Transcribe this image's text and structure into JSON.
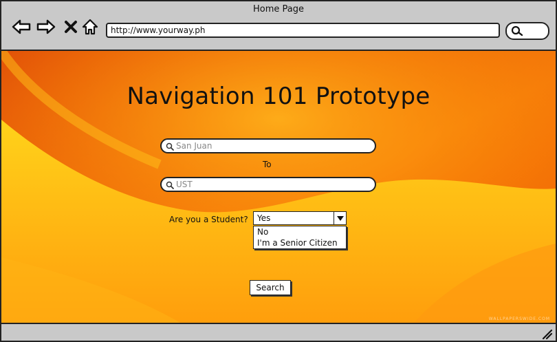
{
  "window": {
    "title": "Home Page",
    "url": "http://www.yourway.ph",
    "nav_icons": [
      "back-arrow-icon",
      "forward-arrow-icon",
      "close-icon",
      "home-icon"
    ],
    "search_icon": "search-icon",
    "resize_icon": "resize-grip-icon"
  },
  "main": {
    "heading": "Navigation 101 Prototype",
    "from_field": {
      "value": "San Juan",
      "icon": "search-icon"
    },
    "to_label": "To",
    "to_field": {
      "value": "UST",
      "icon": "search-icon"
    },
    "student_question": "Are you a Student?",
    "student_select": {
      "selected": "Yes",
      "options": [
        "No",
        "I'm a Senior Citizen"
      ]
    },
    "search_button": "Search"
  },
  "colors": {
    "background_main": "#f06a0a",
    "background_light": "#ffc20e",
    "chrome": "#c9c9c9",
    "ink": "#222222"
  }
}
